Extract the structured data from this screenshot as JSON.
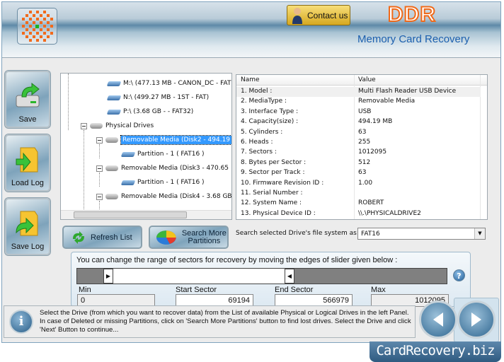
{
  "header": {
    "contact_label": "Contact us",
    "brand": "DDR",
    "product": "Memory Card Recovery"
  },
  "sidebar": {
    "items": [
      {
        "label": "Save",
        "icon": "save-drive-icon"
      },
      {
        "label": "Load Log",
        "icon": "load-folder-icon"
      },
      {
        "label": "Save Log",
        "icon": "save-folder-icon"
      }
    ]
  },
  "tree": {
    "items": [
      {
        "label": "M:\\ (477.13 MB - CANON_DC - FAT",
        "level": 2,
        "type": "logical"
      },
      {
        "label": "N:\\ (499.27 MB - 1ST - FAT)",
        "level": 2,
        "type": "logical"
      },
      {
        "label": "P:\\ (3.68 GB -  - FAT32)",
        "level": 2,
        "type": "logical"
      },
      {
        "label": "Physical Drives",
        "level": 0,
        "type": "group"
      },
      {
        "label": "Removable Media (Disk2 - 494.19",
        "level": 1,
        "type": "disk",
        "selected": true
      },
      {
        "label": "Partition - 1 ( FAT16 )",
        "level": 2,
        "type": "partition"
      },
      {
        "label": "Removable Media (Disk3 - 470.65",
        "level": 1,
        "type": "disk"
      },
      {
        "label": "Partition - 1 ( FAT16 )",
        "level": 2,
        "type": "partition"
      },
      {
        "label": "Removable Media (Disk4 - 3.68 GB",
        "level": 1,
        "type": "disk"
      }
    ]
  },
  "table": {
    "columns": [
      "Name",
      "Value"
    ],
    "rows": [
      [
        "1. Model :",
        "Multi Flash Reader USB Device"
      ],
      [
        "2. MediaType :",
        "Removable Media"
      ],
      [
        "3. Interface Type :",
        "USB"
      ],
      [
        "4. Capacity(size) :",
        "494.19 MB"
      ],
      [
        "5. Cylinders :",
        "63"
      ],
      [
        "6. Heads :",
        "255"
      ],
      [
        "7. Sectors :",
        "1012095"
      ],
      [
        "8. Bytes per Sector :",
        "512"
      ],
      [
        "9. Sector per Track :",
        "63"
      ],
      [
        "10. Firmware Revision ID :",
        "1.00"
      ],
      [
        "11. Serial Number :",
        ""
      ],
      [
        "12. System Name :",
        "ROBERT"
      ],
      [
        "13. Physical Device ID :",
        "\\\\.\\PHYSICALDRIVE2"
      ]
    ]
  },
  "buttons": {
    "refresh": "Refresh List",
    "search_more": "Search More Partitions"
  },
  "filesystem": {
    "label": "Search selected Drive's file system as:",
    "value": "FAT16"
  },
  "slider": {
    "instruction": "You can change the range of sectors for recovery by moving the edges of slider given below :",
    "min_label": "Min",
    "start_label": "Start Sector",
    "end_label": "End Sector",
    "max_label": "Max",
    "min": "0",
    "start": "69194",
    "end": "566979",
    "max": "1012095"
  },
  "info": {
    "text": "Select the Drive (from which you want to recover data) from the List of available Physical or Logical Drives in the left Panel. In case of Deleted or missing Partitions, click on 'Search More Partitions' button to find lost drives. Select the Drive and click 'Next' Button to continue..."
  },
  "footer": {
    "site": "CardRecovery.biz"
  },
  "colors": {
    "accent": "#1b5fae",
    "selection": "#3399ff",
    "brand": "#f06a1a"
  }
}
